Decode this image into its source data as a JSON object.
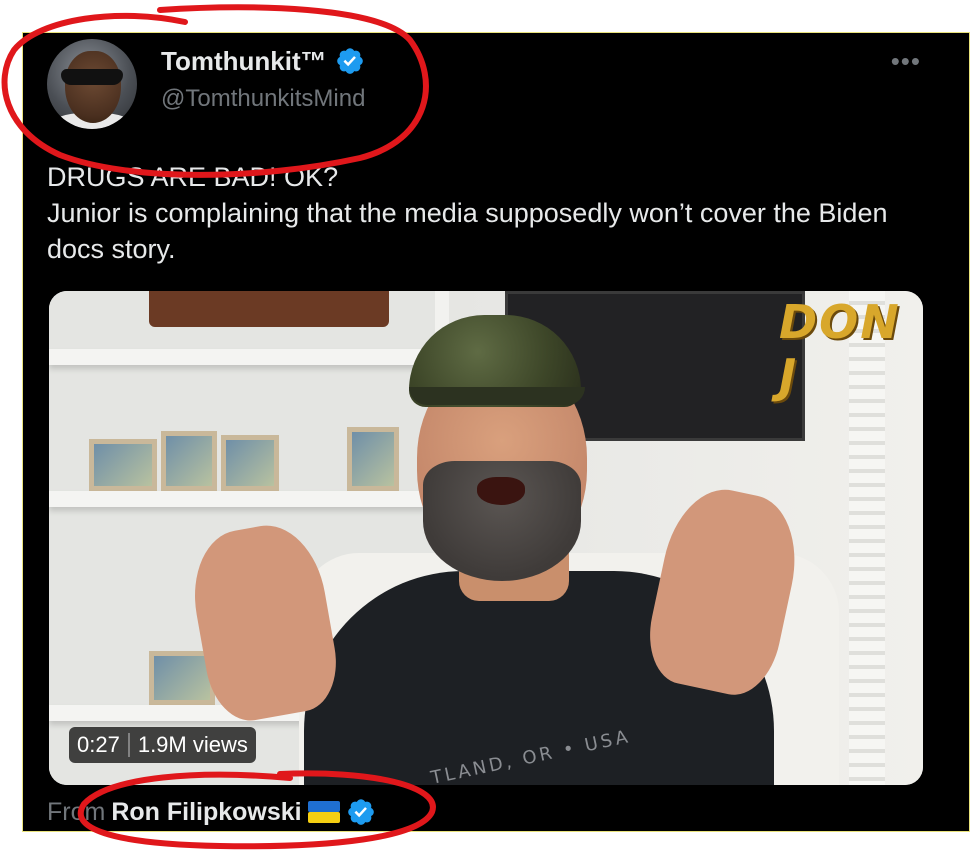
{
  "tweet": {
    "display_name": "Tomthunkit™",
    "handle": "@TomthunkitsMind",
    "text": "DRUGS ARE BAD! OK?\nJunior is complaining that the media supposedly won’t cover the Biden docs story.",
    "more_icon": "more-dots-icon",
    "verified_icon": "verified-badge-icon"
  },
  "media": {
    "brand_text": "DON J",
    "shirt_print": "TLAND, OR • USA",
    "duration": "0:27",
    "views": "1.9M views"
  },
  "attribution": {
    "from_label": "From",
    "author": "Ron Filipkowski",
    "flag_icon": "ukraine-flag-icon"
  },
  "colors": {
    "background": "#000000",
    "primary_text": "#e7e9ea",
    "secondary_text": "#71767b",
    "verified": "#1d9bf0",
    "annotation": "#e0171b"
  }
}
